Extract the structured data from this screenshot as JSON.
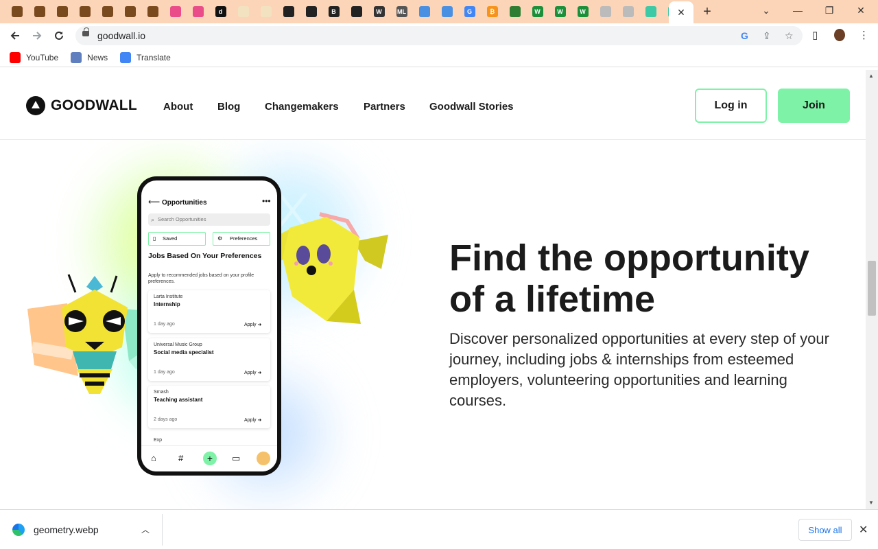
{
  "browser": {
    "active_tab_close": "✕",
    "new_tab": "+",
    "controls": {
      "minimize": "—",
      "restore": "❐",
      "close": "✕",
      "tab_list": "⌄"
    },
    "url": "goodwall.io",
    "tab_favicons": [
      {
        "icon": "book-icon",
        "color": "#7a4a1f",
        "glyph": ""
      },
      {
        "icon": "book-icon",
        "color": "#7a4a1f",
        "glyph": ""
      },
      {
        "icon": "book-icon",
        "color": "#7a4a1f",
        "glyph": ""
      },
      {
        "icon": "book-icon",
        "color": "#7a4a1f",
        "glyph": ""
      },
      {
        "icon": "book-icon",
        "color": "#7a4a1f",
        "glyph": ""
      },
      {
        "icon": "book-icon",
        "color": "#7a4a1f",
        "glyph": ""
      },
      {
        "icon": "book-icon",
        "color": "#7a4a1f",
        "glyph": ""
      },
      {
        "icon": "dribbble-icon",
        "color": "#ea4c89",
        "glyph": ""
      },
      {
        "icon": "dribbble-icon",
        "color": "#ea4c89",
        "glyph": ""
      },
      {
        "icon": "dev-icon",
        "color": "#111111",
        "glyph": "d"
      },
      {
        "icon": "page-icon",
        "color": "#f3e2c0",
        "glyph": ""
      },
      {
        "icon": "page-icon",
        "color": "#f3e2c0",
        "glyph": ""
      },
      {
        "icon": "globe-icon",
        "color": "#222222",
        "glyph": ""
      },
      {
        "icon": "globe-icon",
        "color": "#222222",
        "glyph": ""
      },
      {
        "icon": "b-icon",
        "color": "#222222",
        "glyph": "B"
      },
      {
        "icon": "globe-icon",
        "color": "#222222",
        "glyph": ""
      },
      {
        "icon": "webflow-icon",
        "color": "#333333",
        "glyph": "W"
      },
      {
        "icon": "ml-icon",
        "color": "#555555",
        "glyph": "ML"
      },
      {
        "icon": "reddit-icon",
        "color": "#4a90e2",
        "glyph": ""
      },
      {
        "icon": "reddit-icon",
        "color": "#4a90e2",
        "glyph": ""
      },
      {
        "icon": "google-icon",
        "color": "#4285f4",
        "glyph": "G"
      },
      {
        "icon": "bitcoin-icon",
        "color": "#f7931a",
        "glyph": "₿"
      },
      {
        "icon": "link-icon",
        "color": "#2e7d32",
        "glyph": ""
      },
      {
        "icon": "w-icon",
        "color": "#1b8f3a",
        "glyph": "W"
      },
      {
        "icon": "w-icon",
        "color": "#1b8f3a",
        "glyph": "W"
      },
      {
        "icon": "w-icon",
        "color": "#1b8f3a",
        "glyph": "W"
      },
      {
        "icon": "github-icon",
        "color": "#bbbbbb",
        "glyph": ""
      },
      {
        "icon": "github-icon",
        "color": "#bbbbbb",
        "glyph": ""
      },
      {
        "icon": "swirl-icon",
        "color": "#3cc9a6",
        "glyph": ""
      },
      {
        "icon": "swirl-icon",
        "color": "#3cc9a6",
        "glyph": ""
      }
    ],
    "bookmarks": [
      {
        "label": "YouTube",
        "icon": "youtube-icon",
        "color": "#ff0000"
      },
      {
        "label": "News",
        "icon": "news-icon",
        "color": "#5f7fbf"
      },
      {
        "label": "Translate",
        "icon": "translate-icon",
        "color": "#4285f4"
      }
    ]
  },
  "site": {
    "logo_text": "GOODWALL",
    "nav": [
      "About",
      "Blog",
      "Changemakers",
      "Partners",
      "Goodwall Stories"
    ],
    "login_label": "Log in",
    "join_label": "Join",
    "accent_color": "#7ef2a6"
  },
  "hero": {
    "title": "Find the opportunity of a lifetime",
    "subtitle": "Discover personalized opportunities at every step of your journey, including jobs & internships from esteemed employers, volunteering opportunities and learning courses."
  },
  "phone": {
    "title": "Opportunities",
    "search_placeholder": "Search Opportunities",
    "chip_saved": "Saved",
    "chip_preferences": "Preferences",
    "heading": "Jobs Based On Your Preferences",
    "description": "Apply to recommended jobs based on your profile preferences.",
    "jobs": [
      {
        "company": "Larta Institute",
        "role": "Internship",
        "age": "1 day ago",
        "apply": "Apply ➜"
      },
      {
        "company": "Universal Music Group",
        "role": "Social media specialist",
        "age": "1 day ago",
        "apply": "Apply ➜"
      },
      {
        "company": "Smash",
        "role": "Teaching assistant",
        "age": "2 days ago",
        "apply": "Apply ➜"
      }
    ],
    "next_item_partial": "Exp"
  },
  "downloads": {
    "file_name": "geometry.webp",
    "show_all": "Show all"
  }
}
